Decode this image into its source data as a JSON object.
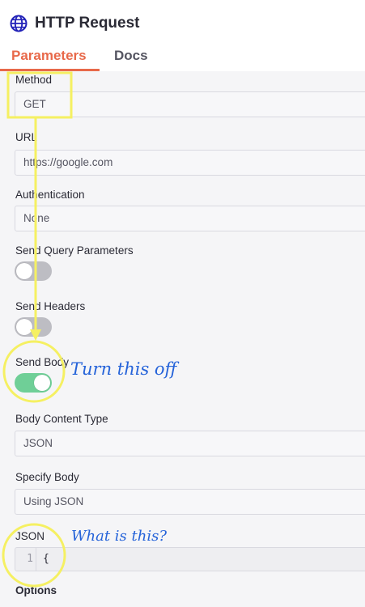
{
  "header": {
    "title": "HTTP Request",
    "icon": "globe-icon",
    "icon_color": "#2222b8"
  },
  "tabs": [
    {
      "label": "Parameters",
      "active": true
    },
    {
      "label": "Docs",
      "active": false
    }
  ],
  "colors": {
    "accent": "#e8694a",
    "toggle_on": "#6fcf97",
    "toggle_off": "#bdbdc3",
    "annotation_yellow": "#f5f062",
    "annotation_blue": "#2563d9"
  },
  "fields": {
    "method": {
      "label": "Method",
      "value": "GET"
    },
    "url": {
      "label": "URL",
      "value": "https://google.com"
    },
    "authentication": {
      "label": "Authentication",
      "value": "None"
    },
    "send_query_parameters": {
      "label": "Send Query Parameters",
      "enabled": false
    },
    "send_headers": {
      "label": "Send Headers",
      "enabled": false
    },
    "send_body": {
      "label": "Send Body",
      "enabled": true
    },
    "body_content_type": {
      "label": "Body Content Type",
      "value": "JSON"
    },
    "specify_body": {
      "label": "Specify Body",
      "value": "Using JSON"
    },
    "json": {
      "label": "JSON",
      "line_number": "1",
      "code": "{"
    },
    "options": {
      "label": "Options"
    }
  },
  "annotations": {
    "turn_off": "Turn this off",
    "what_is_this": "What is this?"
  }
}
